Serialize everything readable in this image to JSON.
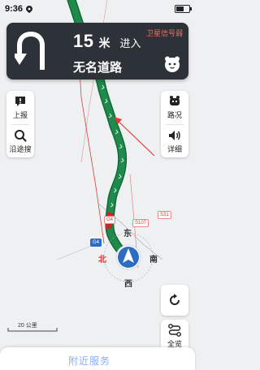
{
  "status": {
    "time": "9:36",
    "battery_percent": 58
  },
  "guidance": {
    "distance": "15",
    "unit": "米",
    "action": "进入",
    "road": "无名道路",
    "gps_status": "卫星信号弱"
  },
  "left_buttons": [
    {
      "label": "上报",
      "icon": "report-icon"
    },
    {
      "label": "沿途搜",
      "icon": "search-icon"
    }
  ],
  "right_buttons": [
    {
      "label": "路况",
      "icon": "traffic-icon"
    },
    {
      "label": "详细",
      "icon": "volume-icon"
    }
  ],
  "bottom_right_buttons": [
    {
      "label": "",
      "icon": "refresh-icon"
    },
    {
      "label": "全览",
      "icon": "overview-icon"
    }
  ],
  "map": {
    "compass": {
      "north": "北",
      "east": "东",
      "south": "南",
      "west": "西"
    },
    "badges": [
      {
        "text": "G4",
        "style": "g"
      },
      {
        "text": "S107",
        "style": "r"
      },
      {
        "text": "G4",
        "style": "r"
      },
      {
        "text": "S31",
        "style": "r"
      }
    ],
    "scale": "20 公里"
  },
  "bottom": {
    "text": "附近服务"
  },
  "colors": {
    "route": "#1f8a4c",
    "route_dark": "#0f6b36",
    "card": "#2d3138",
    "location": "#2c6cc3",
    "arrow": "#e53935"
  }
}
